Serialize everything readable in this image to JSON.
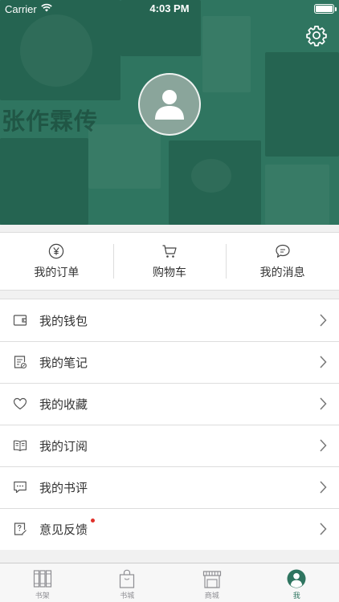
{
  "status_bar": {
    "carrier": "Carrier",
    "time": "4:03 PM"
  },
  "header": {
    "background_text": "张作霖传",
    "accent_color": "#2f7560"
  },
  "quick_actions": [
    {
      "label": "我的订单",
      "icon": "yen-icon"
    },
    {
      "label": "购物车",
      "icon": "cart-icon"
    },
    {
      "label": "我的消息",
      "icon": "message-icon"
    }
  ],
  "menu": [
    {
      "label": "我的钱包",
      "icon": "wallet-icon"
    },
    {
      "label": "我的笔记",
      "icon": "note-icon"
    },
    {
      "label": "我的收藏",
      "icon": "heart-icon"
    },
    {
      "label": "我的订阅",
      "icon": "book-icon"
    },
    {
      "label": "我的书评",
      "icon": "comment-icon"
    },
    {
      "label": "意见反馈",
      "icon": "feedback-icon",
      "badge_dot": true
    }
  ],
  "tabbar": [
    {
      "label": "书架",
      "icon": "bookshelf-icon"
    },
    {
      "label": "书城",
      "icon": "bag-icon"
    },
    {
      "label": "商城",
      "icon": "store-icon"
    },
    {
      "label": "我",
      "icon": "profile-icon",
      "active": true
    }
  ]
}
